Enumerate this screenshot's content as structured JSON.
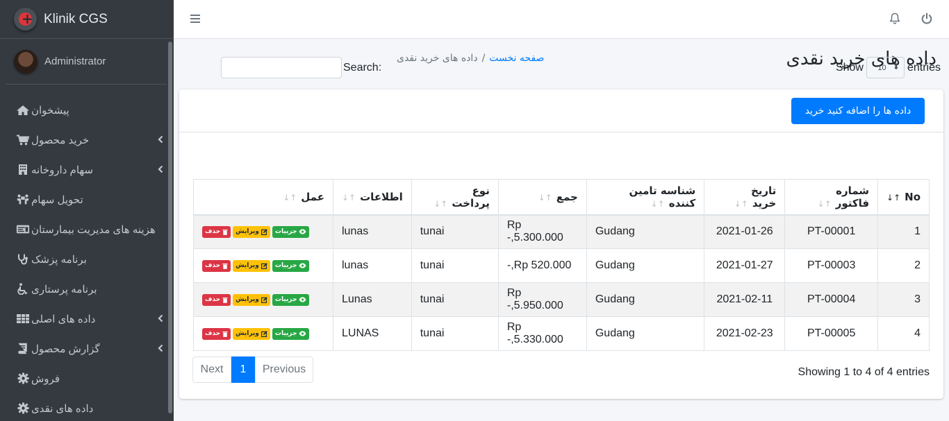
{
  "app": {
    "brand": "Klinik CGS"
  },
  "user": {
    "name": "Administrator"
  },
  "sidebar": {
    "items": [
      {
        "label": "پیشخوان",
        "icon": "home-icon",
        "has_children": false
      },
      {
        "label": "خرید محصول",
        "icon": "cart-icon",
        "has_children": true
      },
      {
        "label": "سهام داروخانه",
        "icon": "building-icon",
        "has_children": true
      },
      {
        "label": "تحویل سهام",
        "icon": "people-carry-icon",
        "has_children": false
      },
      {
        "label": "هزینه های مدیریت بیمارستان",
        "icon": "money-check-icon",
        "has_children": false
      },
      {
        "label": "برنامه پزشک",
        "icon": "stethoscope-icon",
        "has_children": false
      },
      {
        "label": "برنامه پرستاری",
        "icon": "wheelchair-icon",
        "has_children": false
      },
      {
        "label": "داده های اصلی",
        "icon": "table-icon",
        "has_children": true
      },
      {
        "label": "گزارش محصول",
        "icon": "book-icon",
        "has_children": true
      },
      {
        "label": "فروش",
        "icon": "cog-icon",
        "has_children": false
      },
      {
        "label": "داده های نقدی",
        "icon": "cog-icon",
        "has_children": false
      }
    ]
  },
  "header": {
    "title": "داده های خرید نقدی",
    "breadcrumb": {
      "home": "صفحه نخست",
      "separator": "/",
      "current": "داده های خرید نقدی"
    }
  },
  "card": {
    "add_button": "داده ها را اضافه کنید خرید"
  },
  "controls": {
    "show_label": "Show",
    "entries_label": "entries",
    "page_length": "10",
    "search_label": "Search:"
  },
  "table": {
    "columns": [
      "No",
      "شماره فاکتور",
      "تاریخ خرید",
      "شناسه تامین کننده",
      "جمع",
      "نوع پرداخت",
      "اطلاعات",
      "عمل"
    ],
    "rows": [
      {
        "no": "1",
        "invoice": "PT-00001",
        "date": "2021-01-26",
        "supplier": "Gudang",
        "total": "Rp 5.300.000,-",
        "payment": "tunai",
        "info": "lunas"
      },
      {
        "no": "2",
        "invoice": "PT-00003",
        "date": "2021-01-27",
        "supplier": "Gudang",
        "total": "Rp 520.000,-",
        "payment": "tunai",
        "info": "lunas"
      },
      {
        "no": "3",
        "invoice": "PT-00004",
        "date": "2021-02-11",
        "supplier": "Gudang",
        "total": "Rp 5.950.000,-",
        "payment": "tunai",
        "info": "Lunas"
      },
      {
        "no": "4",
        "invoice": "PT-00005",
        "date": "2021-02-23",
        "supplier": "Gudang",
        "total": "Rp 5.330.000,-",
        "payment": "tunai",
        "info": "LUNAS"
      }
    ],
    "actions": {
      "details": "جزییات",
      "edit": "ویرایش",
      "delete": "حذف"
    }
  },
  "footer": {
    "info": "Showing 1 to 4 of 4 entries",
    "pager": {
      "next": "Next",
      "current": "1",
      "previous": "Previous"
    }
  },
  "colors": {
    "primary": "#007bff",
    "success": "#28a745",
    "warning": "#ffc107",
    "danger": "#dc3545",
    "sidebar": "#343a40"
  }
}
